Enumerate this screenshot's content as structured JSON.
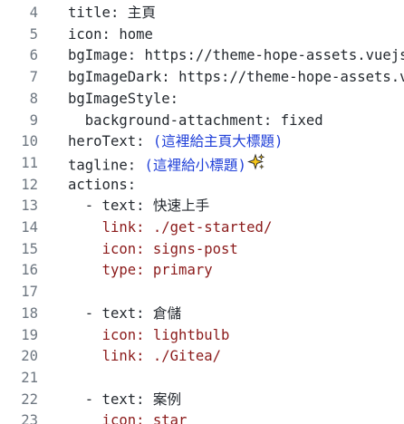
{
  "editor": {
    "lines": [
      {
        "n": "4",
        "indent": "",
        "key": "title: ",
        "val": "主頁",
        "valClass": "cjk"
      },
      {
        "n": "5",
        "indent": "",
        "key": "icon: ",
        "val": "home",
        "valClass": "key"
      },
      {
        "n": "6",
        "indent": "",
        "key": "bgImage: ",
        "val": "https://theme-hope-assets.vuejs.press",
        "valClass": "key"
      },
      {
        "n": "7",
        "indent": "",
        "key": "bgImageDark: ",
        "val": "https://theme-hope-assets.vuejs.press",
        "valClass": "key"
      },
      {
        "n": "8",
        "indent": "",
        "key": "bgImageStyle:",
        "val": "",
        "valClass": "key"
      },
      {
        "n": "9",
        "indent": "  ",
        "key": "background-attachment: ",
        "val": "fixed",
        "valClass": "key"
      },
      {
        "n": "10",
        "indent": "",
        "key": "heroText: ",
        "paren": "(這裡給主頁大標題)"
      },
      {
        "n": "11",
        "indent": "",
        "key": "tagline: ",
        "paren": "(這裡給小標題)",
        "emoji": "sparkles-icon"
      },
      {
        "n": "12",
        "indent": "",
        "key": "actions:",
        "val": "",
        "valClass": "key"
      },
      {
        "n": "13",
        "indent": "  ",
        "key": "- text: ",
        "val": "快速上手",
        "valClass": "cjk"
      },
      {
        "n": "14",
        "indent": "    ",
        "key": "",
        "red": "link: ./get-started/"
      },
      {
        "n": "15",
        "indent": "    ",
        "key": "",
        "red": "icon: signs-post"
      },
      {
        "n": "16",
        "indent": "    ",
        "key": "",
        "red": "type: primary"
      },
      {
        "n": "17",
        "indent": "",
        "key": "",
        "val": "",
        "valClass": "key"
      },
      {
        "n": "18",
        "indent": "  ",
        "key": "- text: ",
        "val": "倉儲",
        "valClass": "cjk"
      },
      {
        "n": "19",
        "indent": "    ",
        "key": "",
        "red": "icon: lightbulb"
      },
      {
        "n": "20",
        "indent": "    ",
        "key": "",
        "red": "link: ./Gitea/"
      },
      {
        "n": "21",
        "indent": "",
        "key": "",
        "val": "",
        "valClass": "key"
      },
      {
        "n": "22",
        "indent": "  ",
        "key": "- text: ",
        "val": "案例",
        "valClass": "cjk"
      },
      {
        "n": "23",
        "indent": "    ",
        "key": "",
        "red": "icon: star"
      }
    ]
  },
  "colors": {
    "line_number": "#6e7781",
    "key": "#24292f",
    "string_red": "#8b1a1a",
    "paren_blue": "#1f3fd8",
    "sparkle_yellow": "#f5c518"
  }
}
